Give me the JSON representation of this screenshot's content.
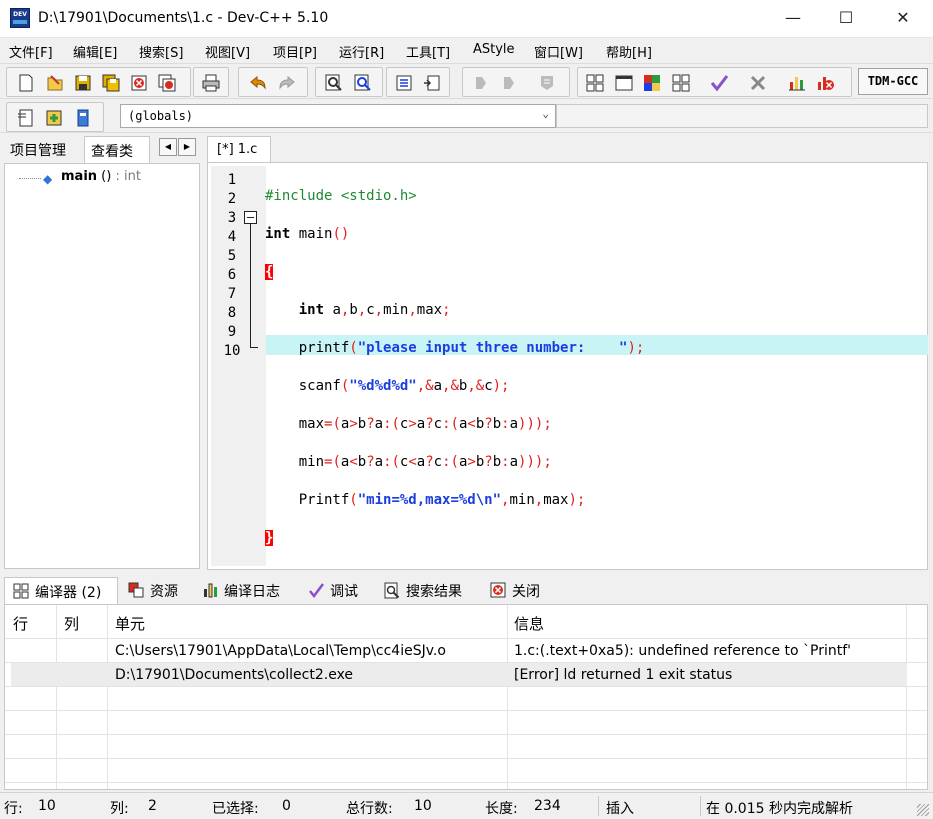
{
  "window": {
    "title": "D:\\17901\\Documents\\1.c - Dev-C++ 5.10",
    "icon_text": "DEV",
    "min_icon": "—",
    "max_icon": "☐",
    "close_icon": "✕"
  },
  "menu": [
    "文件[F]",
    "编辑[E]",
    "搜索[S]",
    "视图[V]",
    "项目[P]",
    "运行[R]",
    "工具[T]",
    "AStyle",
    "窗口[W]",
    "帮助[H]"
  ],
  "toolbar": {
    "compiler": "TDM-GCC",
    "scope_combo": "(globals)"
  },
  "left_panel": {
    "tabs": [
      "项目管理",
      "查看类"
    ],
    "nav_prev": "◀",
    "nav_next": "▶",
    "tree_item": {
      "name": "main",
      "sig": " () ",
      "type": ": int"
    }
  },
  "editor": {
    "tab_label": "[*] 1.c",
    "line_numbers": [
      "1",
      "2",
      "3",
      "4",
      "5",
      "6",
      "7",
      "8",
      "9",
      "10"
    ],
    "current_line": 10
  },
  "bottom_tabs": [
    "编译器 (2)",
    "资源",
    "编译日志",
    "调试",
    "搜索结果",
    "关闭"
  ],
  "results": {
    "columns": [
      "行",
      "列",
      "单元",
      "信息"
    ],
    "rows": [
      {
        "line": "",
        "col": "",
        "unit": "C:\\Users\\17901\\AppData\\Local\\Temp\\cc4ieSJv.o",
        "message": "1.c:(.text+0xa5): undefined reference to `Printf'"
      },
      {
        "line": "",
        "col": "",
        "unit": "D:\\17901\\Documents\\collect2.exe",
        "message": "[Error] ld returned 1 exit status"
      }
    ]
  },
  "status": {
    "line_label": "行:",
    "line_value": "10",
    "col_label": "列:",
    "col_value": "2",
    "sel_label": "已选择:",
    "sel_value": "0",
    "total_label": "总行数:",
    "total_value": "10",
    "len_label": "长度:",
    "len_value": "234",
    "mode": "插入",
    "parse": "在 0.015 秒内完成解析"
  },
  "colors": {
    "current_line": "#c8f4f6",
    "preprocessor": "#1e8b2f",
    "string": "#1b3ee0",
    "symbol": "#e0201c",
    "brace_bg": "#ff0000"
  }
}
